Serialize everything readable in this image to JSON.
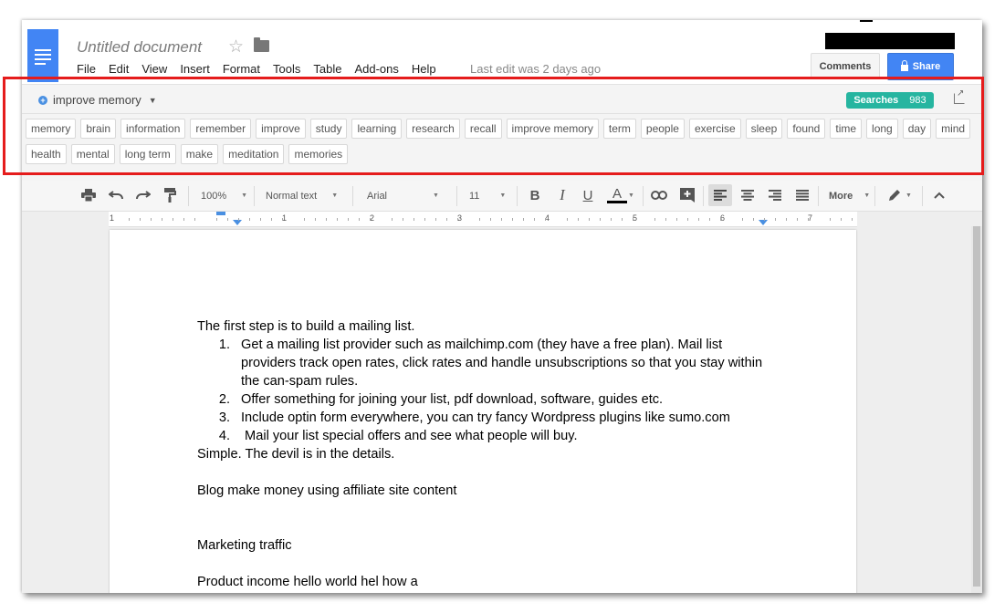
{
  "app": {
    "title": "Untitled document",
    "menu": [
      "File",
      "Edit",
      "View",
      "Insert",
      "Format",
      "Tools",
      "Table",
      "Add-ons",
      "Help"
    ],
    "last_edit": "Last edit was 2 days ago",
    "comments_label": "Comments",
    "share_label": "Share"
  },
  "keywords": {
    "query": "improve memory",
    "searches_label": "Searches",
    "searches_count": "983",
    "chips": [
      "memory",
      "brain",
      "information",
      "remember",
      "improve",
      "study",
      "learning",
      "research",
      "recall",
      "improve memory",
      "term",
      "people",
      "exercise",
      "sleep",
      "found",
      "time",
      "long",
      "day",
      "mind",
      "health",
      "mental",
      "long term",
      "make",
      "meditation",
      "memories"
    ]
  },
  "toolbar": {
    "zoom": "100%",
    "style": "Normal text",
    "font": "Arial",
    "size": "11",
    "bold": "B",
    "italic": "I",
    "underline": "U",
    "text_color": "A",
    "more": "More"
  },
  "ruler": {
    "numbers": [
      "1",
      "1",
      "2",
      "3",
      "4",
      "5",
      "6",
      "7"
    ]
  },
  "document": {
    "intro": "The first step is to build a mailing list.",
    "list": [
      {
        "num": "1.",
        "text": "Get a mailing list provider such as mailchimp.com (they have a free plan). Mail list providers track open rates, click rates and handle unsubscriptions so that you stay within the can-spam rules."
      },
      {
        "num": "2.",
        "text": "Offer something for joining your list, pdf download, software, guides etc."
      },
      {
        "num": "3.",
        "text": "Include optin form everywhere, you can try fancy Wordpress plugins like sumo.com"
      },
      {
        "num": "4.",
        "text": " Mail your list special offers and see what people will buy."
      }
    ],
    "simple": "Simple. The devil is in the details.",
    "blog": "Blog make money using affiliate site content",
    "marketing": "Marketing traffic",
    "product": "Product income hello world hel how a"
  },
  "colors": {
    "brand_blue": "#4285f4",
    "searches_teal": "#26b5a0",
    "highlight_red": "#e51c1c"
  }
}
